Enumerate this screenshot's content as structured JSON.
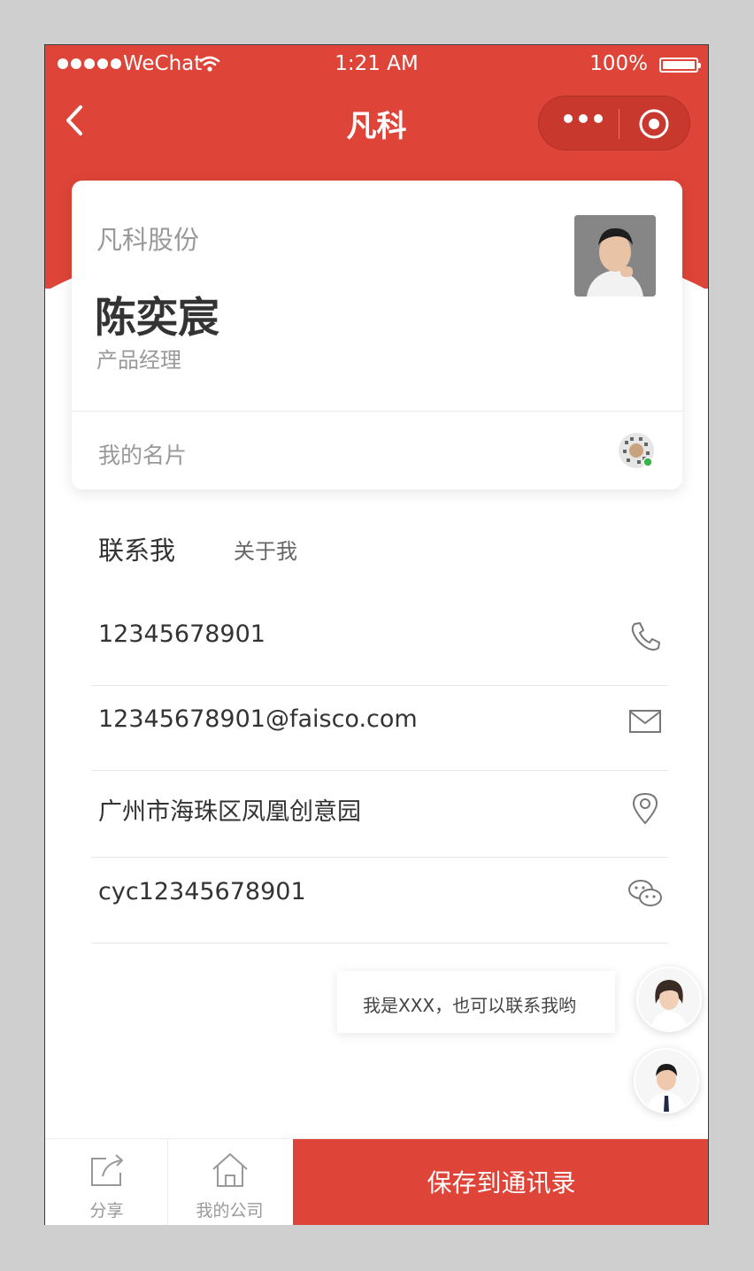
{
  "status_bar": {
    "carrier": "WeChat",
    "time": "1:21 AM",
    "battery": "100%"
  },
  "nav": {
    "title": "凡科"
  },
  "card": {
    "company": "凡科股份",
    "name": "陈奕宸",
    "position": "产品经理",
    "my_card_label": "我的名片"
  },
  "tabs": {
    "active": "联系我",
    "inactive": "关于我"
  },
  "contacts": [
    {
      "value": "12345678901",
      "icon": "phone-icon"
    },
    {
      "value": "12345678901@faisco.com",
      "icon": "mail-icon"
    },
    {
      "value": "广州市海珠区凤凰创意园",
      "icon": "location-icon"
    },
    {
      "value": "cyc12345678901",
      "icon": "wechat-icon"
    }
  ],
  "chat_bubble": {
    "text": "我是XXX，也可以联系我哟"
  },
  "bottom_bar": {
    "share": "分享",
    "company": "我的公司",
    "save": "保存到通讯录"
  },
  "colors": {
    "brand_red": "#de4437",
    "text_dark": "#333333",
    "text_gray": "#999999"
  }
}
